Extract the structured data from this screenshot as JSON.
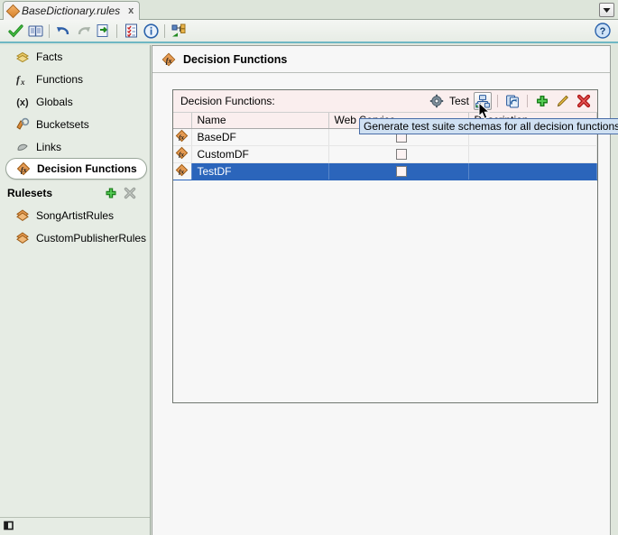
{
  "window": {
    "tab_label": "BaseDictionary.rules",
    "tab_close": "x",
    "tab_icon": "diamond-dictionary-icon",
    "dropdown_icon": "chevron-down-icon",
    "help_icon": "help-question-icon"
  },
  "app_toolbar": {
    "buttons": [
      {
        "name": "validate-check-icon",
        "glyph": "check"
      },
      {
        "name": "dictionary-book-icon",
        "glyph": "book"
      },
      {
        "name": "undo-icon",
        "glyph": "undo"
      },
      {
        "name": "redo-icon",
        "glyph": "redo",
        "disabled": true
      },
      {
        "name": "export-document-icon",
        "glyph": "export"
      },
      {
        "name": "test-checklist-icon",
        "glyph": "checklist"
      },
      {
        "name": "info-icon",
        "glyph": "info"
      },
      {
        "name": "merge-links-icon",
        "glyph": "merge"
      }
    ]
  },
  "sidebar": {
    "items": [
      {
        "label": "Facts",
        "icon": "facts-stack-icon",
        "selected": false
      },
      {
        "label": "Functions",
        "icon": "function-fx-icon",
        "selected": false
      },
      {
        "label": "Globals",
        "icon": "globals-x-icon",
        "selected": false
      },
      {
        "label": "Bucketsets",
        "icon": "bucketsets-icon",
        "selected": false
      },
      {
        "label": "Links",
        "icon": "links-icon",
        "selected": false
      },
      {
        "label": "Decision Functions",
        "icon": "decision-function-icon",
        "selected": true
      }
    ],
    "rulesets": {
      "header": "Rulesets",
      "add_icon": "add-plus-icon",
      "delete_icon": "delete-x-icon",
      "items": [
        {
          "label": "SongArtistRules",
          "icon": "ruleset-diamond-icon"
        },
        {
          "label": "CustomPublisherRules",
          "icon": "ruleset-diamond-icon"
        }
      ]
    },
    "status_icon": "collapse-panel-icon"
  },
  "main": {
    "page_title": "Decision Functions",
    "page_icon": "decision-function-icon",
    "panel": {
      "toolbar_label": "Decision Functions:",
      "test_label": "Test",
      "test_icon": "test-gear-icon",
      "generate_schemas_icon": "generate-schemas-icon",
      "refresh_icon": "refresh-sync-icon",
      "add_icon": "add-plus-icon",
      "edit_icon": "edit-pencil-icon",
      "delete_icon": "delete-x-icon",
      "columns": [
        "",
        "Name",
        "Web Service",
        "Description"
      ],
      "rows": [
        {
          "icon": "decision-function-icon",
          "name": "BaseDF",
          "web_service": false,
          "description": "",
          "selected": false
        },
        {
          "icon": "decision-function-icon",
          "name": "CustomDF",
          "web_service": false,
          "description": "",
          "selected": false
        },
        {
          "icon": "decision-function-icon",
          "name": "TestDF",
          "web_service": false,
          "description": "",
          "selected": true
        }
      ]
    }
  },
  "tooltip": {
    "text": "Generate test suite schemas for all decision functions"
  },
  "colors": {
    "sidebar_bg": "#e6ece4",
    "panel_toolbar_bg": "#faeeee",
    "selection_blue": "#2b65bb",
    "tooltip_bg": "#cfe0f2",
    "accent_rule": "#6fb7c4"
  }
}
